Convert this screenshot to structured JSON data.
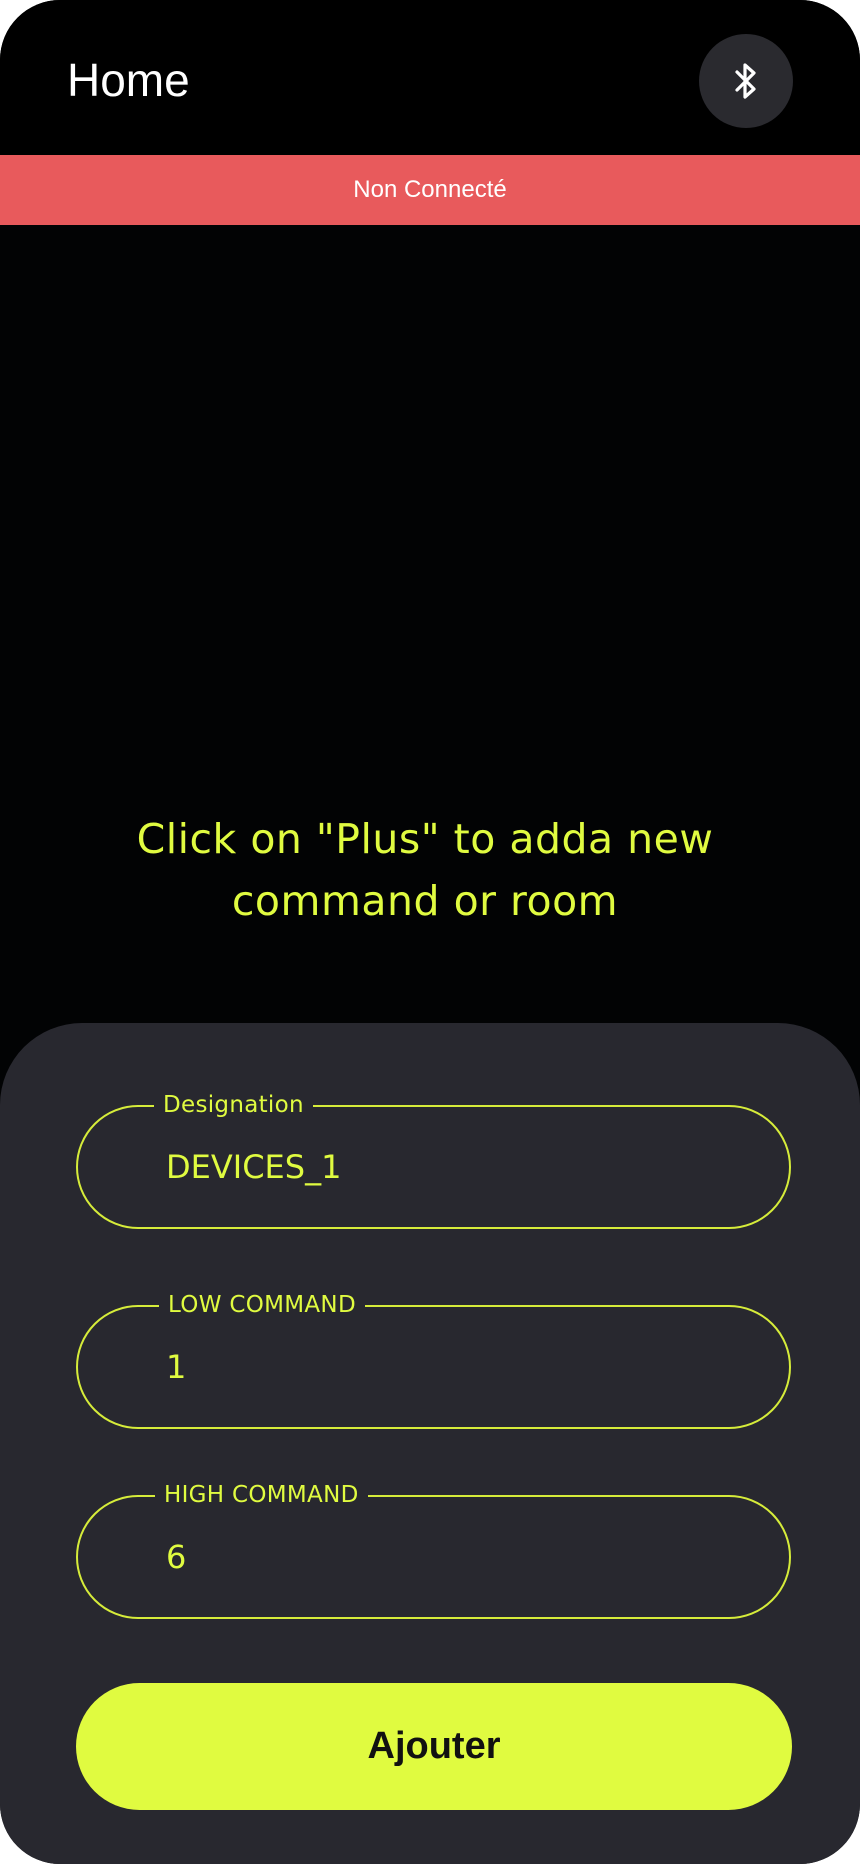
{
  "app_bar": {
    "title": "Home",
    "bluetooth_icon": "bluetooth-icon"
  },
  "status": {
    "text": "Non Connecté",
    "color": "#e85a5c"
  },
  "empty_state": {
    "message": "Click on \"Plus\" to adda new command or room"
  },
  "form": {
    "designation": {
      "label": "Designation",
      "value": "DEVICES_1"
    },
    "low_command": {
      "label": "LOW COMMAND",
      "value": "1"
    },
    "high_command": {
      "label": "HIGH COMMAND",
      "value": "6"
    },
    "submit_label": "Ajouter"
  },
  "colors": {
    "accent": "#e0fb40",
    "background": "#020304",
    "sheet": "#28282f",
    "error": "#e85a5c"
  }
}
